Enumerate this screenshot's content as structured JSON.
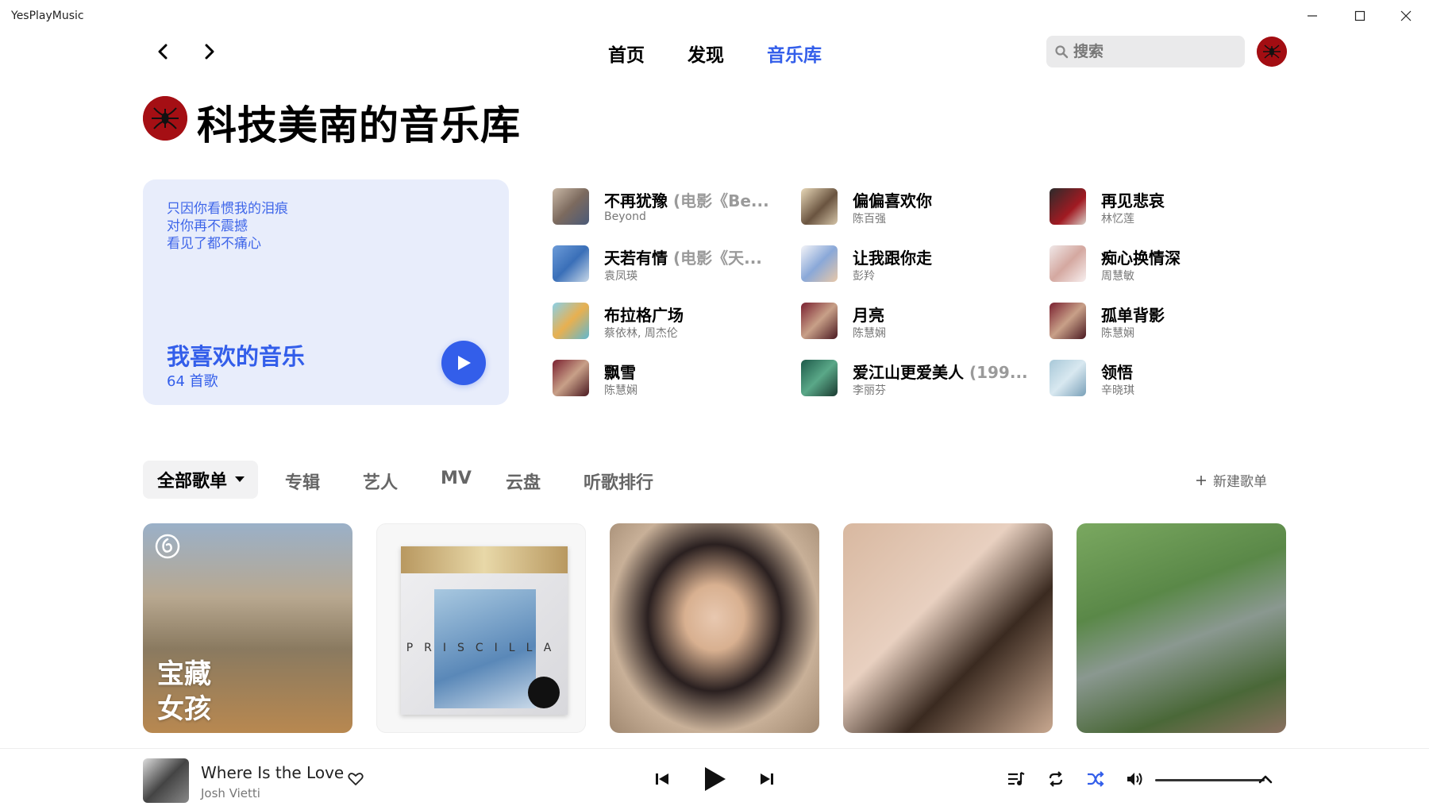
{
  "app": {
    "title": "YesPlayMusic"
  },
  "nav": {
    "tabs": [
      "首页",
      "发现",
      "音乐库"
    ],
    "active_tab": "音乐库",
    "search_placeholder": "搜索",
    "accent_color": "#335eea"
  },
  "library": {
    "title": "科技美南的音乐库",
    "liked_card": {
      "lyrics": [
        "只因你看惯我的泪痕",
        "对你再不震撼",
        "看见了都不痛心"
      ],
      "title": "我喜欢的音乐",
      "count": "64 首歌"
    },
    "songs": [
      {
        "title": "不再犹豫",
        "extra": " (电影《Be...",
        "artist": "Beyond"
      },
      {
        "title": "偏偏喜欢你",
        "extra": "",
        "artist": "陈百强"
      },
      {
        "title": "再见悲哀",
        "extra": "",
        "artist": "林忆莲"
      },
      {
        "title": "天若有情",
        "extra": " (电影《天...",
        "artist": "袁凤瑛"
      },
      {
        "title": "让我跟你走",
        "extra": "",
        "artist": "彭羚"
      },
      {
        "title": "痴心换情深",
        "extra": "",
        "artist": "周慧敏"
      },
      {
        "title": "布拉格广场",
        "extra": "",
        "artist": "蔡依林, 周杰伦"
      },
      {
        "title": "月亮",
        "extra": "",
        "artist": "陈慧娴"
      },
      {
        "title": "孤单背影",
        "extra": "",
        "artist": "陈慧娴"
      },
      {
        "title": "飘雪",
        "extra": "",
        "artist": "陈慧娴"
      },
      {
        "title": "爱江山更爱美人",
        "extra": " (199...",
        "artist": "李丽芬"
      },
      {
        "title": "领悟",
        "extra": "",
        "artist": "辛晓琪"
      }
    ],
    "tabs": {
      "active": "全部歌单",
      "items": [
        "专辑",
        "艺人",
        "MV",
        "云盘",
        "听歌排行"
      ],
      "new_playlist": "新建歌单"
    },
    "playlists": [
      {
        "overlay_text_line1": "宝藏",
        "overlay_text_line2": "女孩"
      },
      {
        "cover_text": "PRISCILLA"
      },
      {},
      {},
      {}
    ]
  },
  "player": {
    "title": "Where Is the Love",
    "artist": "Josh Vietti"
  }
}
